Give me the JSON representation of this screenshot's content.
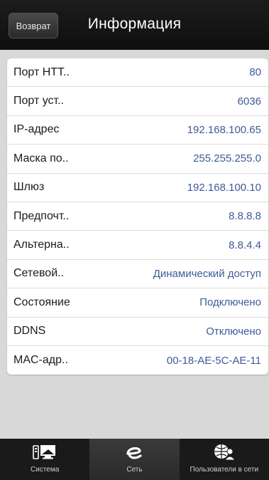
{
  "header": {
    "back_label": "Возврат",
    "title": "Информация"
  },
  "rows": [
    {
      "label": "Порт НТТ..",
      "value": "80"
    },
    {
      "label": "Порт уст..",
      "value": "6036"
    },
    {
      "label": "IP-адрес",
      "value": "192.168.100.65"
    },
    {
      "label": "Маска по..",
      "value": "255.255.255.0"
    },
    {
      "label": "Шлюз",
      "value": "192.168.100.10"
    },
    {
      "label": "Предпочт..",
      "value": "8.8.8.8"
    },
    {
      "label": "Альтерна..",
      "value": "8.8.4.4"
    },
    {
      "label": "Сетевой..",
      "value": "Динамический доступ"
    },
    {
      "label": "Состояние",
      "value": "Подключено"
    },
    {
      "label": "DDNS",
      "value": "Отключено"
    },
    {
      "label": "MAC-адр..",
      "value": "00-18-AE-5C-AE-11"
    }
  ],
  "tabs": [
    {
      "label": "Система",
      "icon": "monitor-icon",
      "active": false
    },
    {
      "label": "Сеть",
      "icon": "network-e-icon",
      "active": true
    },
    {
      "label": "Пользователи в сети",
      "icon": "globe-users-icon",
      "active": false
    }
  ],
  "colors": {
    "value_text": "#3d5b9a",
    "header_bg": "#111111",
    "content_bg": "#d8d8d8"
  }
}
